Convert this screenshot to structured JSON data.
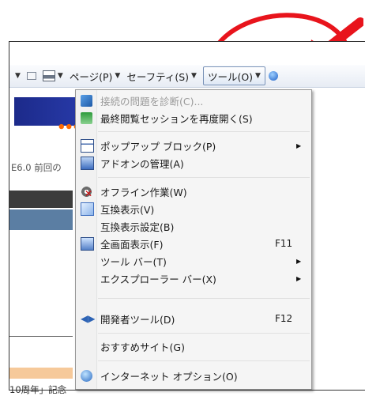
{
  "toolbar": {
    "page_label": "ページ(P)",
    "safety_label": "セーフティ(S)",
    "tools_label": "ツール(O)"
  },
  "page_behind": {
    "text1": "E6.0 前回の",
    "text2": "10周年」記念"
  },
  "menu": {
    "items": [
      {
        "label": "接続の問題を診断(C)...",
        "icon": "network-diagnose-icon",
        "disabled": true
      },
      {
        "label": "最終閲覧セッションを再度開く(S)",
        "icon": "reopen-session-icon"
      },
      {
        "label": "ポップアップ ブロック(P)",
        "icon": "popup-blocker-icon",
        "submenu": true
      },
      {
        "label": "アドオンの管理(A)",
        "icon": "manage-addons-icon"
      },
      {
        "label": "オフライン作業(W)",
        "icon": "work-offline-icon"
      },
      {
        "label": "互換表示(V)",
        "icon": "compatibility-view-icon"
      },
      {
        "label": "互換表示設定(B)"
      },
      {
        "label": "全画面表示(F)",
        "icon": "full-screen-icon",
        "shortcut": "F11"
      },
      {
        "label": "ツール バー(T)",
        "submenu": true
      },
      {
        "label": "エクスプローラー バー(X)",
        "submenu": true
      },
      {
        "label": "開発者ツール(D)",
        "icon": "developer-tools-icon",
        "shortcut": "F12"
      },
      {
        "label": "おすすめサイト(G)"
      },
      {
        "label": "インターネット オプション(O)",
        "icon": "internet-options-icon"
      }
    ]
  },
  "annotation": {
    "color": "#e8141c"
  }
}
